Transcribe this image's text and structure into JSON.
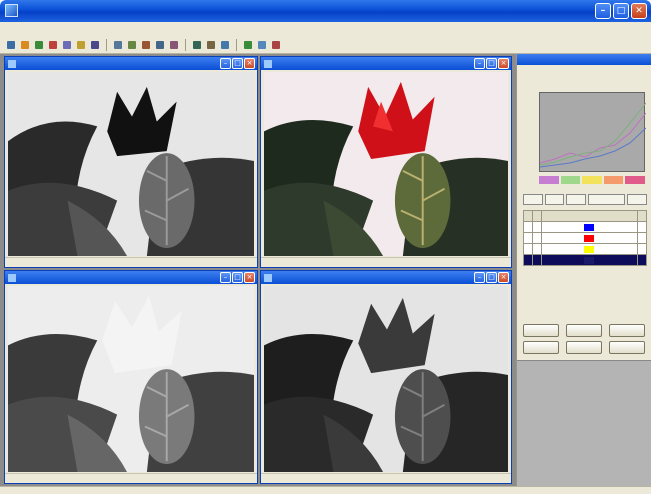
{
  "app": {
    "title": ""
  },
  "menu": [],
  "toolbar": {
    "icons": [
      "open-icon",
      "save-icon",
      "print-icon",
      "cut-icon",
      "copy-icon",
      "paste-icon",
      "undo-icon",
      "pointer-icon",
      "select-icon",
      "lasso-icon",
      "brush-icon",
      "eraser-icon",
      "zoom-in-icon",
      "zoom-out-icon",
      "fit-icon",
      "help-icon",
      "info-icon",
      "exit-icon"
    ],
    "colors": [
      "#3a6ea5",
      "#d98b1e",
      "#3a8c3a",
      "#c04040",
      "#6b6bb8",
      "#c0a030",
      "#4a4a8a",
      "#557799",
      "#668844",
      "#995533",
      "#446688",
      "#885577",
      "#336655",
      "#776644",
      "#4477aa",
      "#3a8c3a",
      "#5588bb",
      "#aa4444"
    ]
  },
  "windows": [
    {
      "title": "",
      "tone": "gray",
      "status": [
        "",
        ""
      ]
    },
    {
      "title": "",
      "tone": "color",
      "status": [
        "",
        ""
      ]
    },
    {
      "title": "",
      "tone": "light",
      "status": [
        "",
        ""
      ]
    },
    {
      "title": "",
      "tone": "dark",
      "status": [
        "",
        ""
      ]
    }
  ],
  "panel": {
    "title": "",
    "subtitle": "",
    "section": "",
    "legend": [
      {
        "color": "#c77dd1"
      },
      {
        "color": "#9fd88a"
      },
      {
        "color": "#f2e25c"
      },
      {
        "color": "#f59a6a"
      },
      {
        "color": "#e05a8a"
      }
    ],
    "tools": [
      "",
      "",
      "",
      "",
      ""
    ],
    "table_header": [
      "",
      "",
      "",
      ""
    ],
    "rows": [
      {
        "swatch": "#0000ff"
      },
      {
        "swatch": "#ff0000"
      },
      {
        "swatch": "#ffff00"
      },
      {
        "swatch": "#1a1a6a"
      }
    ],
    "buttons": [
      "",
      "",
      "",
      "",
      "",
      ""
    ]
  },
  "status": [
    "",
    "",
    "",
    ""
  ],
  "colors": {
    "accent": "#0a4fd6",
    "chrome": "#ece9d8"
  }
}
